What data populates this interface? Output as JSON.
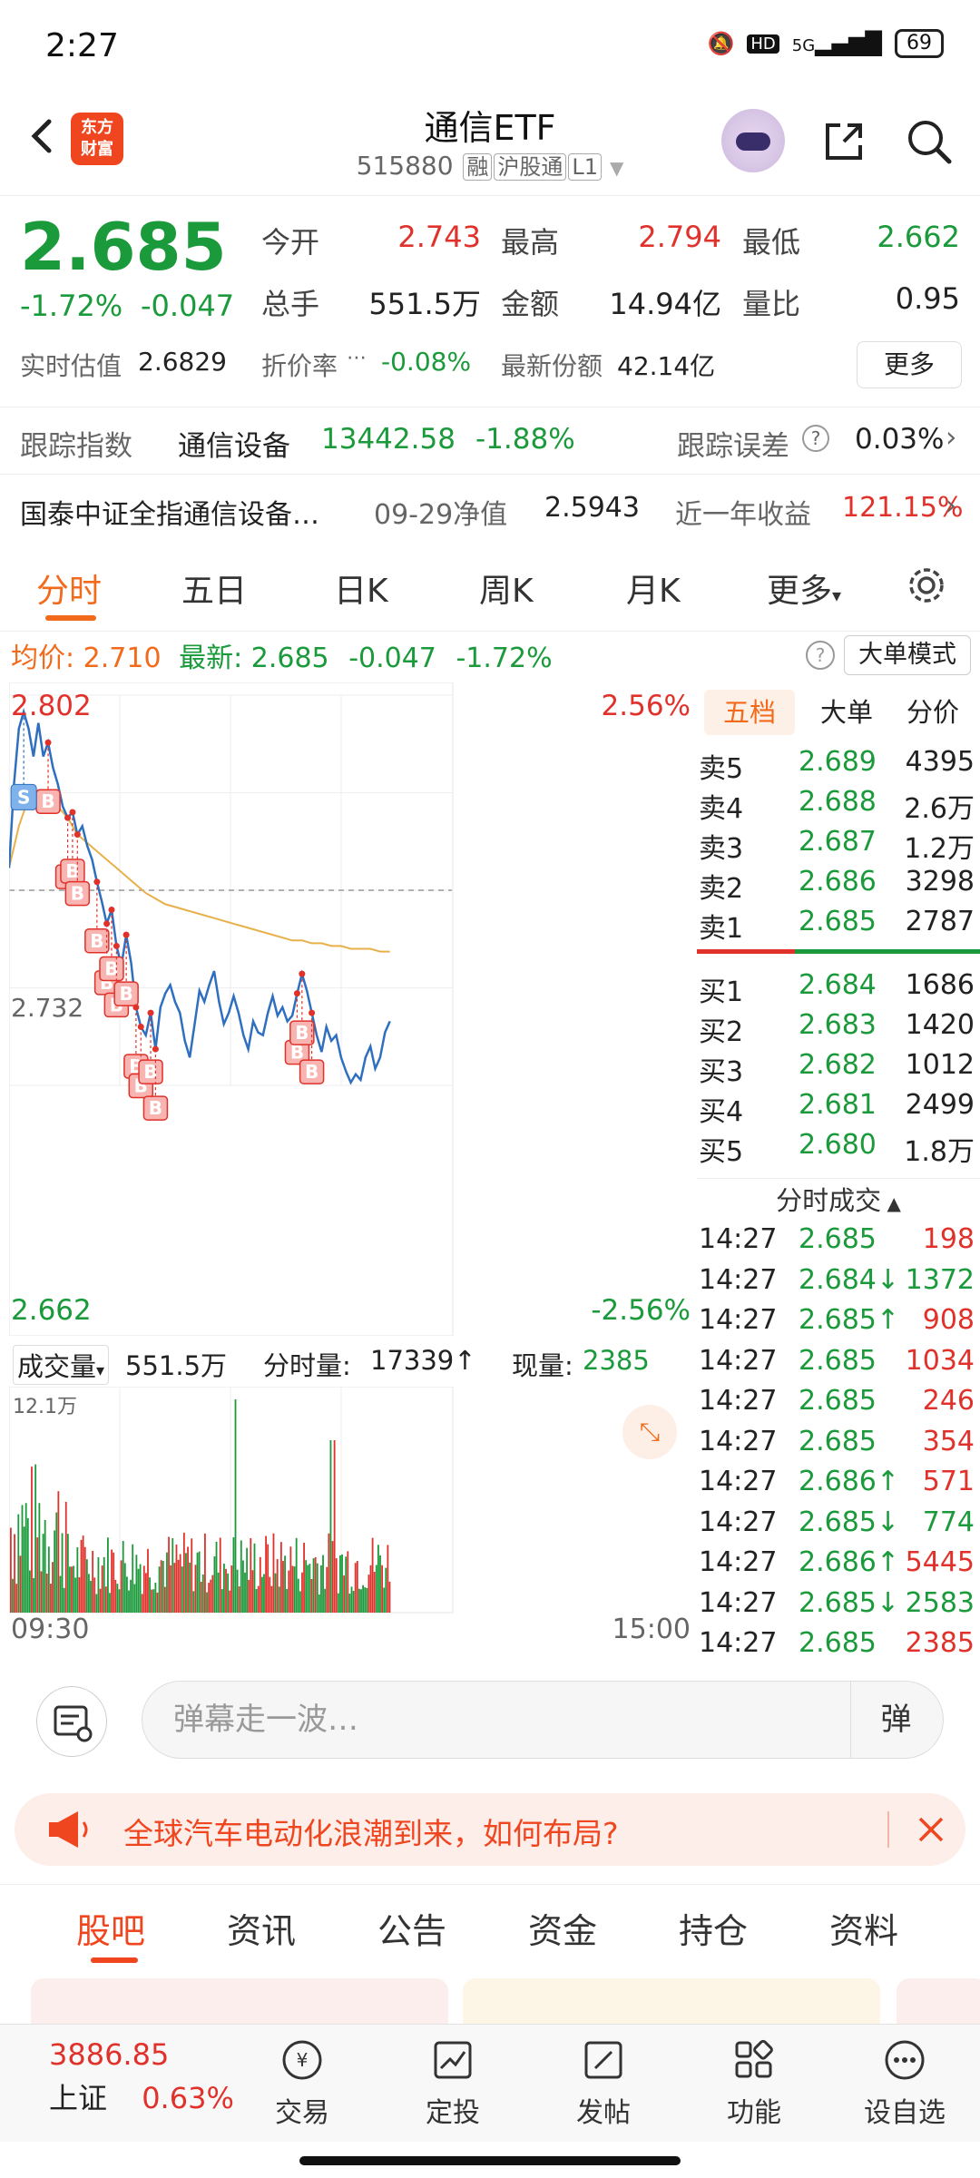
{
  "status_bar": {
    "time": "2:27",
    "network": "5G",
    "hd": "HD",
    "battery": "69"
  },
  "header": {
    "title": "通信ETF",
    "code": "515880",
    "tags": [
      "融",
      "沪股通",
      "L1"
    ],
    "logo_line1": "东方",
    "logo_line2": "财富"
  },
  "quote": {
    "price": "2.685",
    "change_pct": "-1.72%",
    "change": "-0.047",
    "open_label": "今开",
    "open": "2.743",
    "high_label": "最高",
    "high": "2.794",
    "low_label": "最低",
    "low": "2.662",
    "volume_label": "总手",
    "volume": "551.5万",
    "amount_label": "金额",
    "amount": "14.94亿",
    "ratio_label": "量比",
    "ratio": "0.95",
    "iopv_label": "实时估值",
    "iopv": "2.6829",
    "discount_label": "折价率",
    "discount": "-0.08%",
    "shares_label": "最新份额",
    "shares": "42.14亿",
    "more": "更多"
  },
  "tracking": {
    "label": "跟踪指数",
    "index": "通信设备",
    "value": "13442.58",
    "pct": "-1.88%",
    "error_label": "跟踪误差",
    "error": "0.03%"
  },
  "fund": {
    "name": "国泰中证全指通信设备…",
    "nav_label": "09-29净值",
    "nav": "2.5943",
    "return_label": "近一年收益",
    "return": "121.15%"
  },
  "tabs": [
    "分时",
    "五日",
    "日K",
    "周K",
    "月K",
    "更多"
  ],
  "avgline": {
    "avg_label": "均价:",
    "avg": "2.710",
    "last_label": "最新:",
    "last": "2.685",
    "chg": "-0.047",
    "pct": "-1.72%",
    "big_order": "大单模式"
  },
  "chart_data": {
    "type": "line",
    "title": "",
    "y_top_label": "2.802",
    "y_mid_label": "2.732",
    "y_bottom_label": "2.662",
    "pct_top": "2.56%",
    "pct_bottom": "-2.56%",
    "ylim": [
      2.662,
      2.802
    ],
    "x_start": "09:30",
    "x_end": "15:00",
    "prev_close": 2.732,
    "series": [
      {
        "values": [
          2.74,
          2.77,
          2.79,
          2.796,
          2.79,
          2.78,
          2.792,
          2.78,
          2.785,
          2.776,
          2.77,
          2.762,
          2.758,
          2.76,
          2.752,
          2.755,
          2.748,
          2.743,
          2.735,
          2.728,
          2.72,
          2.725,
          2.712,
          2.705,
          2.716,
          2.706,
          2.69,
          2.683,
          2.68,
          2.688,
          2.675,
          2.69,
          2.695,
          2.698,
          2.692,
          2.688,
          2.678,
          2.672,
          2.684,
          2.696,
          2.692,
          2.698,
          2.703,
          2.692,
          2.684,
          2.688,
          2.694,
          2.688,
          2.68,
          2.675,
          2.685,
          2.681,
          2.68,
          2.688,
          2.694,
          2.687,
          2.69,
          2.685,
          2.687,
          2.695,
          2.702,
          2.696,
          2.688,
          2.68,
          2.674,
          2.683,
          2.678,
          2.68,
          2.672,
          2.667,
          2.663,
          2.666,
          2.664,
          2.672,
          2.676,
          2.668,
          2.672,
          2.681,
          2.685
        ]
      },
      {
        "values": [
          2.74,
          2.755,
          2.765,
          2.768,
          2.766,
          2.762,
          2.758,
          2.752,
          2.749,
          2.746,
          2.743,
          2.74,
          2.737,
          2.734,
          2.731,
          2.729,
          2.727,
          2.726,
          2.725,
          2.724,
          2.723,
          2.722,
          2.721,
          2.72,
          2.719,
          2.718,
          2.717,
          2.716,
          2.715,
          2.714,
          2.714,
          2.713,
          2.713,
          2.712,
          2.712,
          2.711,
          2.711,
          2.711,
          2.71,
          2.71
        ]
      }
    ]
  },
  "volume": {
    "label": "成交量",
    "total": "551.5万",
    "minute_label": "分时量:",
    "minute": "17339↑",
    "current_label": "现量:",
    "current": "2385",
    "max_label": "12.1万"
  },
  "order_book": {
    "tabs": [
      "五档",
      "大单",
      "分价"
    ],
    "asks": [
      {
        "label": "卖5",
        "price": "2.689",
        "vol": "4395"
      },
      {
        "label": "卖4",
        "price": "2.688",
        "vol": "2.6万"
      },
      {
        "label": "卖3",
        "price": "2.687",
        "vol": "1.2万"
      },
      {
        "label": "卖2",
        "price": "2.686",
        "vol": "3298"
      },
      {
        "label": "卖1",
        "price": "2.685",
        "vol": "2787"
      }
    ],
    "bids": [
      {
        "label": "买1",
        "price": "2.684",
        "vol": "1686"
      },
      {
        "label": "买2",
        "price": "2.683",
        "vol": "1420"
      },
      {
        "label": "买3",
        "price": "2.682",
        "vol": "1012"
      },
      {
        "label": "买4",
        "price": "2.681",
        "vol": "2499"
      },
      {
        "label": "买5",
        "price": "2.680",
        "vol": "1.8万"
      }
    ],
    "trades_title": "分时成交",
    "trades": [
      {
        "time": "14:27",
        "price": "2.685",
        "vol": "198",
        "dir": ""
      },
      {
        "time": "14:27",
        "price": "2.684↓",
        "vol": "1372",
        "dir": "down"
      },
      {
        "time": "14:27",
        "price": "2.685↑",
        "vol": "908",
        "dir": "up"
      },
      {
        "time": "14:27",
        "price": "2.685",
        "vol": "1034",
        "dir": ""
      },
      {
        "time": "14:27",
        "price": "2.685",
        "vol": "246",
        "dir": ""
      },
      {
        "time": "14:27",
        "price": "2.685",
        "vol": "354",
        "dir": ""
      },
      {
        "time": "14:27",
        "price": "2.686↑",
        "vol": "571",
        "dir": "up"
      },
      {
        "time": "14:27",
        "price": "2.685↓",
        "vol": "774",
        "dir": "down"
      },
      {
        "time": "14:27",
        "price": "2.686↑",
        "vol": "5445",
        "dir": "up"
      },
      {
        "time": "14:27",
        "price": "2.685↓",
        "vol": "2583",
        "dir": "down"
      },
      {
        "time": "14:27",
        "price": "2.685",
        "vol": "2385",
        "dir": ""
      }
    ]
  },
  "comment": {
    "placeholder": "弹幕走一波…",
    "danmu": "弹"
  },
  "banner": {
    "text": "全球汽车电动化浪潮到来，如何布局?"
  },
  "bottom_tabs": [
    "股吧",
    "资讯",
    "公告",
    "资金",
    "持仓",
    "资料"
  ],
  "bottom_nav": {
    "index_value": "3886.85",
    "index_name": "上证",
    "index_pct": "0.63%",
    "items": [
      "交易",
      "定投",
      "发帖",
      "功能",
      "设自选"
    ]
  }
}
